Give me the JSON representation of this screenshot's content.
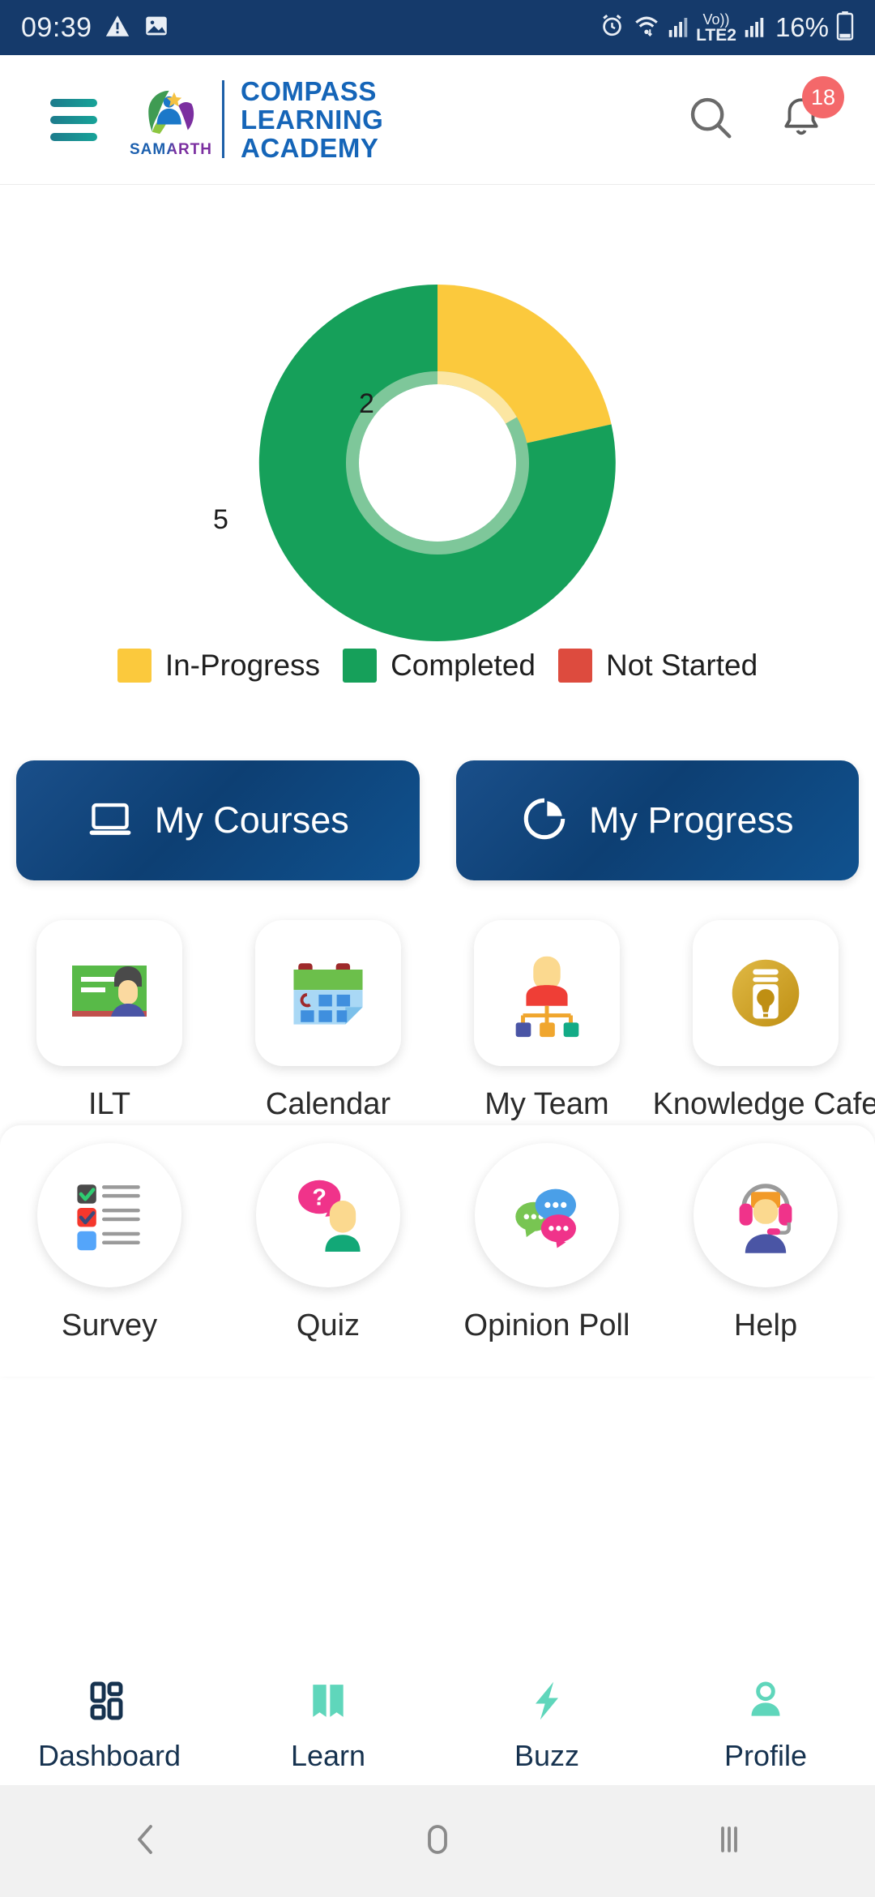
{
  "status_bar": {
    "time": "09:39",
    "battery_percent": "16%",
    "network_label": "LTE2",
    "volte_label": "Vo))",
    "icons": [
      "warning-icon",
      "image-icon",
      "alarm-icon",
      "wifi-icon",
      "signal-icon",
      "volte-icon",
      "signal-icon-2",
      "battery-icon"
    ]
  },
  "header": {
    "menu_icon": "hamburger-icon",
    "logo_sub": "SAMARTH",
    "brand_line1": "COMPASS",
    "brand_line2": "LEARNING",
    "brand_line3": "ACADEMY",
    "search_icon": "search-icon",
    "bell_icon": "bell-icon",
    "notification_count": "18"
  },
  "chart_data": {
    "type": "pie",
    "title": "",
    "categories": [
      "In-Progress",
      "Completed",
      "Not Started"
    ],
    "values": [
      2,
      5,
      0
    ],
    "labels": [
      "2",
      "5"
    ],
    "colors": [
      "#fbc93d",
      "#16a05a",
      "#dd4b3e"
    ],
    "legend_position": "bottom",
    "donut": true
  },
  "legend": [
    {
      "label": "In-Progress",
      "color": "#fbc93d"
    },
    {
      "label": "Completed",
      "color": "#16a05a"
    },
    {
      "label": "Not Started",
      "color": "#dd4b3e"
    }
  ],
  "cta_buttons": [
    {
      "label": "My Courses",
      "icon": "laptop-icon"
    },
    {
      "label": "My Progress",
      "icon": "pie-chart-icon"
    }
  ],
  "tiles_row1": [
    {
      "label": "ILT",
      "icon": "classroom-icon"
    },
    {
      "label": "Calendar",
      "icon": "calendar-icon"
    },
    {
      "label": "My Team",
      "icon": "org-chart-icon"
    },
    {
      "label": "Knowledge Cafe",
      "icon": "knowledge-cafe-icon"
    }
  ],
  "tiles_row2": [
    {
      "label": "Survey",
      "icon": "checklist-icon"
    },
    {
      "label": "Quiz",
      "icon": "question-person-icon"
    },
    {
      "label": "Opinion Poll",
      "icon": "chat-bubbles-icon"
    },
    {
      "label": "Help",
      "icon": "headset-support-icon"
    }
  ],
  "bottom_nav": [
    {
      "label": "Dashboard",
      "icon": "grid-icon",
      "active": true
    },
    {
      "label": "Learn",
      "icon": "book-icon",
      "active": false
    },
    {
      "label": "Buzz",
      "icon": "bolt-icon",
      "active": false
    },
    {
      "label": "Profile",
      "icon": "person-icon",
      "active": false
    }
  ],
  "system_nav": [
    {
      "icon": "back-icon"
    },
    {
      "icon": "home-icon"
    },
    {
      "icon": "recents-icon"
    }
  ],
  "colors": {
    "status_bar": "#153a6b",
    "brand_blue": "#1565b8",
    "cta_gradient_start": "#1a4f8a",
    "cta_gradient_end": "#10528f",
    "nav_active": "#16324f",
    "nav_inactive": "#5fd6bb",
    "badge_red": "#f4686a"
  }
}
